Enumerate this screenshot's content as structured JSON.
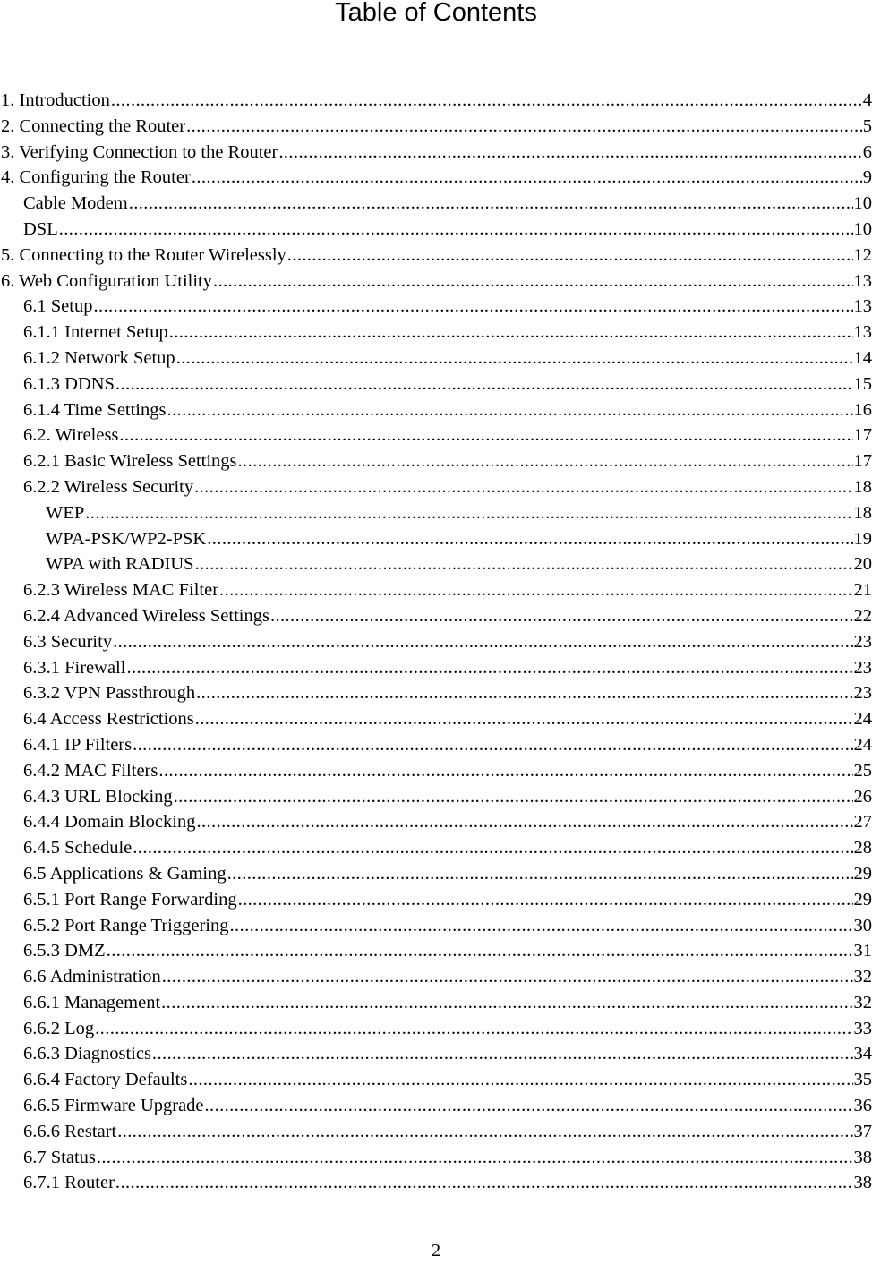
{
  "document": {
    "title": "Table of Contents",
    "page_number": "2"
  },
  "toc": [
    {
      "label": "1. Introduction",
      "page": "4",
      "level": 1
    },
    {
      "label": "2. Connecting the Router",
      "page": "5",
      "level": 1
    },
    {
      "label": "3. Verifying Connection to the Router",
      "page": "6",
      "level": 1
    },
    {
      "label": "4. Configuring the Router",
      "page": "9",
      "level": 1
    },
    {
      "label": "Cable Modem",
      "page": "10",
      "level": 2
    },
    {
      "label": "DSL",
      "page": "10",
      "level": 2
    },
    {
      "label": "5. Connecting to the Router Wirelessly",
      "page": "12",
      "level": 1
    },
    {
      "label": "6. Web Configuration Utility",
      "page": "13",
      "level": 1
    },
    {
      "label": "6.1 Setup",
      "page": "13",
      "level": 2
    },
    {
      "label": "6.1.1 Internet Setup",
      "page": "13",
      "level": 2
    },
    {
      "label": "6.1.2 Network Setup",
      "page": "14",
      "level": 2
    },
    {
      "label": "6.1.3 DDNS",
      "page": "15",
      "level": 2
    },
    {
      "label": "6.1.4 Time Settings",
      "page": "16",
      "level": 2
    },
    {
      "label": "6.2. Wireless",
      "page": "17",
      "level": 2
    },
    {
      "label": "6.2.1 Basic Wireless Settings",
      "page": "17",
      "level": 2
    },
    {
      "label": "6.2.2 Wireless Security",
      "page": "18",
      "level": 2
    },
    {
      "label": "WEP",
      "page": "18",
      "level": 3
    },
    {
      "label": "WPA-PSK/WP2-PSK",
      "page": "19",
      "level": 3
    },
    {
      "label": "WPA with RADIUS",
      "page": "20",
      "level": 3
    },
    {
      "label": "6.2.3 Wireless MAC Filter",
      "page": "21",
      "level": 2
    },
    {
      "label": "6.2.4 Advanced Wireless Settings",
      "page": "22",
      "level": 2
    },
    {
      "label": "6.3 Security",
      "page": "23",
      "level": 2
    },
    {
      "label": "6.3.1 Firewall",
      "page": "23",
      "level": 2
    },
    {
      "label": "6.3.2 VPN Passthrough",
      "page": "23",
      "level": 2
    },
    {
      "label": "6.4 Access Restrictions",
      "page": "24",
      "level": 2
    },
    {
      "label": "6.4.1 IP Filters",
      "page": "24",
      "level": 2
    },
    {
      "label": "6.4.2 MAC Filters",
      "page": "25",
      "level": 2
    },
    {
      "label": "6.4.3 URL Blocking",
      "page": "26",
      "level": 2
    },
    {
      "label": "6.4.4 Domain Blocking",
      "page": "27",
      "level": 2
    },
    {
      "label": "6.4.5 Schedule",
      "page": "28",
      "level": 2
    },
    {
      "label": "6.5 Applications & Gaming",
      "page": "29",
      "level": 2
    },
    {
      "label": "6.5.1 Port Range Forwarding",
      "page": "29",
      "level": 2
    },
    {
      "label": "6.5.2 Port Range Triggering",
      "page": "30",
      "level": 2
    },
    {
      "label": "6.5.3 DMZ",
      "page": "31",
      "level": 2
    },
    {
      "label": "6.6 Administration",
      "page": "32",
      "level": 2
    },
    {
      "label": "6.6.1 Management",
      "page": "32",
      "level": 2
    },
    {
      "label": "6.6.2 Log",
      "page": "33",
      "level": 2
    },
    {
      "label": "6.6.3 Diagnostics",
      "page": "34",
      "level": 2
    },
    {
      "label": "6.6.4 Factory Defaults",
      "page": "35",
      "level": 2
    },
    {
      "label": "6.6.5 Firmware Upgrade",
      "page": "36",
      "level": 2
    },
    {
      "label": "6.6.6 Restart",
      "page": "37",
      "level": 2
    },
    {
      "label": "6.7 Status",
      "page": "38",
      "level": 2
    },
    {
      "label": "6.7.1 Router",
      "page": "38",
      "level": 2
    }
  ]
}
